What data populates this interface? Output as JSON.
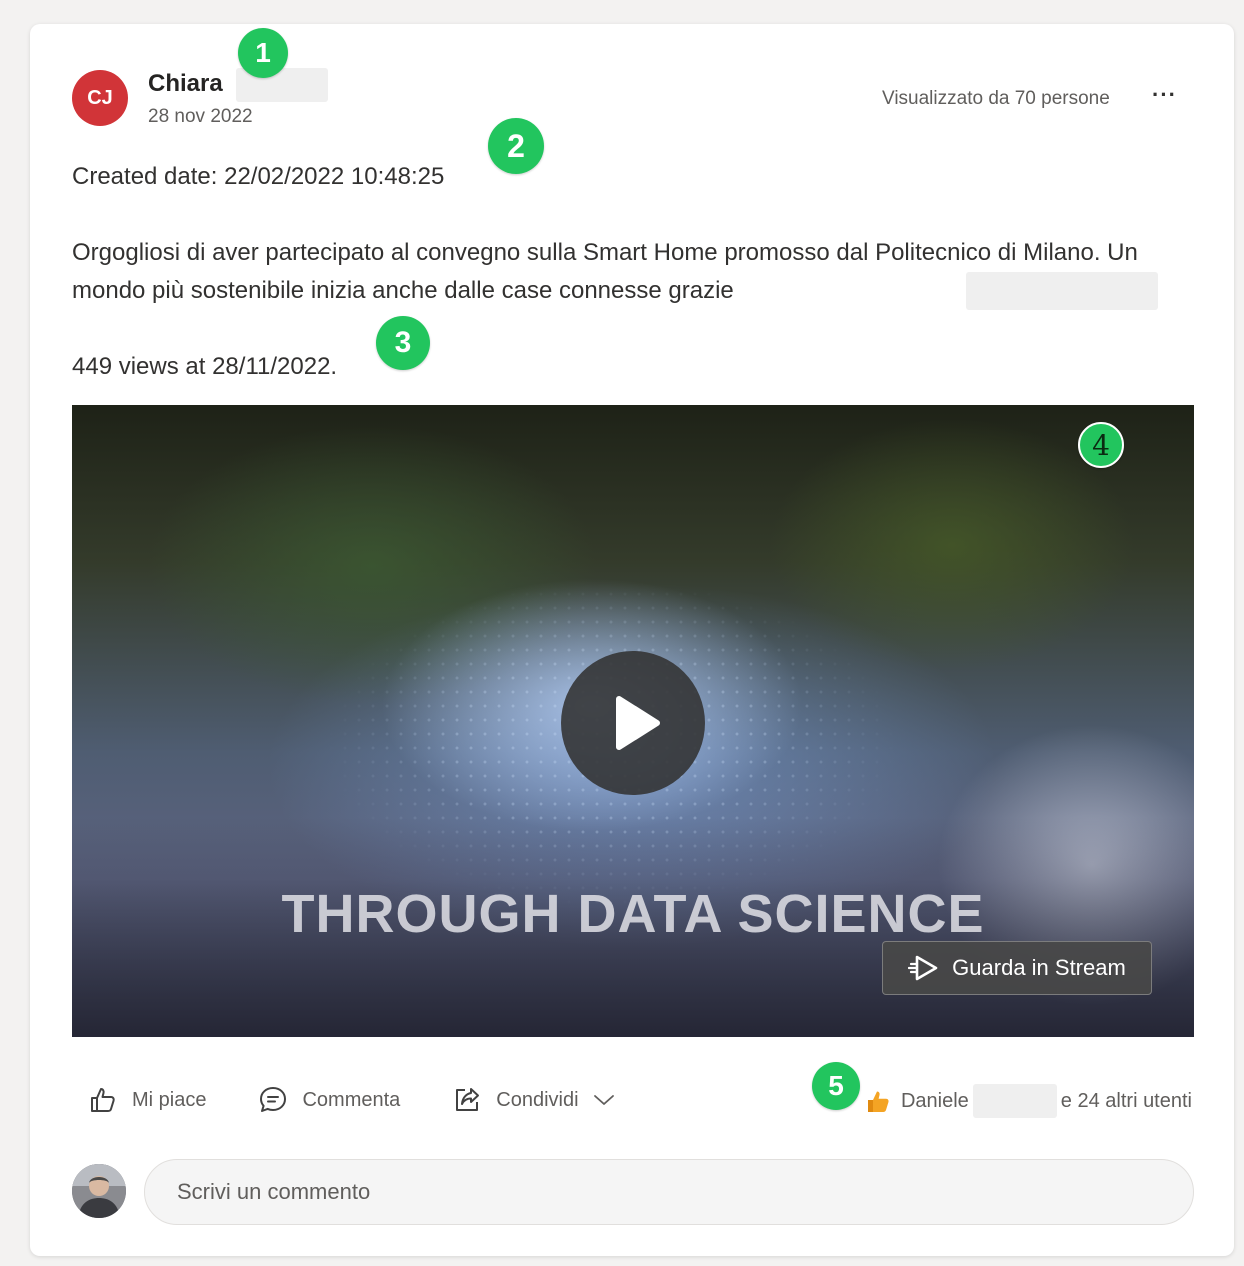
{
  "post": {
    "author_initials": "CJ",
    "author_name": "Chiara",
    "date": "28 nov 2022",
    "seen_by": "Visualizzato da 70 persone",
    "more_label": "···",
    "created_date": "Created date: 22/02/2022 10:48:25",
    "body": "Orgogliosi di aver partecipato al convegno sulla Smart Home promosso dal Politecnico di Milano. Un mondo più sostenibile inizia anche dalle case connesse grazie",
    "views": "449 views at 28/11/2022."
  },
  "video": {
    "caption": "THROUGH DATA SCIENCE",
    "stream_label": "Guarda in Stream"
  },
  "actions": {
    "like": "Mi piace",
    "comment": "Commenta",
    "share": "Condividi"
  },
  "reactions": {
    "first_name": "Daniele",
    "others": "e 24 altri utenti"
  },
  "comment": {
    "placeholder": "Scrivi un commento"
  },
  "badges": [
    "1",
    "2",
    "3",
    "4",
    "5"
  ],
  "colors": {
    "avatar": "#d13438",
    "badge": "#22c55e"
  }
}
